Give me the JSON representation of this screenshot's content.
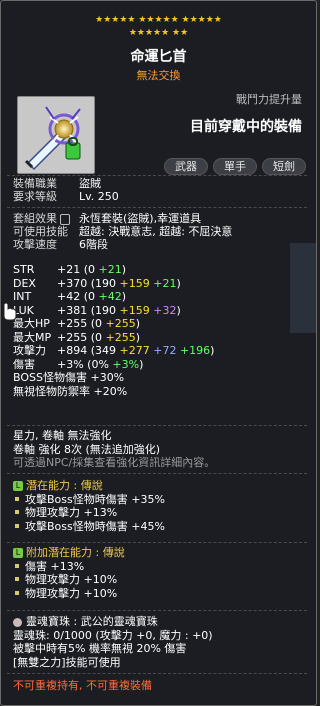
{
  "stars": {
    "row1": "★★★★★  ★★★★★  ★★★★★",
    "row2": "★★★★★  ★★"
  },
  "item": {
    "name": "命運匕首",
    "trade": "無法交換"
  },
  "power": {
    "label": "戰鬥力提升量",
    "current_text": "目前穿戴中的裝備"
  },
  "tags": [
    "武器",
    "單手",
    "短劍"
  ],
  "info": {
    "job_label": "裝備職業",
    "job_value": "盜賊",
    "level_label": "要求等級",
    "level_value": "Lv. 250",
    "set_label": "套組效果",
    "set_value": "永恆套裝(盜賊),幸運道具",
    "skill_label": "可使用技能",
    "skill_value": "超越: 決戰意志, 超越: 不屈決意",
    "speed_label": "攻擊速度",
    "speed_value": "6階段"
  },
  "stats": [
    {
      "name": "STR",
      "value": "+21",
      "detail": "(0 ",
      "star": "",
      "pot": "",
      "flame": "",
      "green": "+21",
      "close": ")"
    },
    {
      "name": "DEX",
      "value": "+370",
      "detail": "(190 ",
      "star": "+159",
      "pot": "",
      "flame": "",
      "green": "+21",
      "close": ")"
    },
    {
      "name": "INT",
      "value": "+42",
      "detail": "(0 ",
      "star": "",
      "pot": "",
      "flame": "",
      "green": "+42",
      "close": ")"
    },
    {
      "name": "LUK",
      "value": "+381",
      "detail": "(190 ",
      "star": "+159",
      "pot": "",
      "flame": "",
      "green": "",
      "purple": "+32",
      "close": ")"
    },
    {
      "name": "最大HP",
      "value": "+255",
      "detail": "(0 ",
      "star": "+255",
      "close": ")"
    },
    {
      "name": "最大MP",
      "value": "+255",
      "detail": "(0 ",
      "star": "+255",
      "close": ")"
    },
    {
      "name": "攻擊力",
      "value": "+894",
      "detail": "(349 ",
      "star": "+277",
      "blue": "+72",
      "green": "+196",
      "close": ")"
    },
    {
      "name": "傷害",
      "value": "+3%",
      "detail": "(0% ",
      "green": "+3%",
      "close": ")"
    }
  ],
  "misc": {
    "boss": "BOSS怪物傷害  +30%",
    "ignore": "無視怪物防禦率  +20%",
    "starforce": "星力, 卷軸 無法強化",
    "scroll": "卷軸 強化 8次 (無法追加強化)",
    "npc_hint": "可透過NPC/採集查看強化資訊詳細內容。"
  },
  "potential": {
    "badge": "L",
    "title": "潛在能力 : 傳說",
    "lines": [
      "攻擊Boss怪物時傷害 +35%",
      "物理攻擊力 +13%",
      "攻擊Boss怪物時傷害 +45%"
    ]
  },
  "additional": {
    "badge": "L",
    "title": "附加潛在能力 : 傳說",
    "lines": [
      "傷害 +13%",
      "物理攻擊力 +10%",
      "物理攻擊力 +10%"
    ]
  },
  "soul": {
    "title": "靈魂寶珠 : 武公的靈魂寶珠",
    "line1": "靈魂珠: 0/1000 (攻擊力 +0, 魔力 : +0)",
    "line2": "被擊中時有5% 機率無視 20% 傷害",
    "line3": "[無雙之力]技能可使用"
  },
  "footer": "不可重複持有, 不可重複裝備"
}
